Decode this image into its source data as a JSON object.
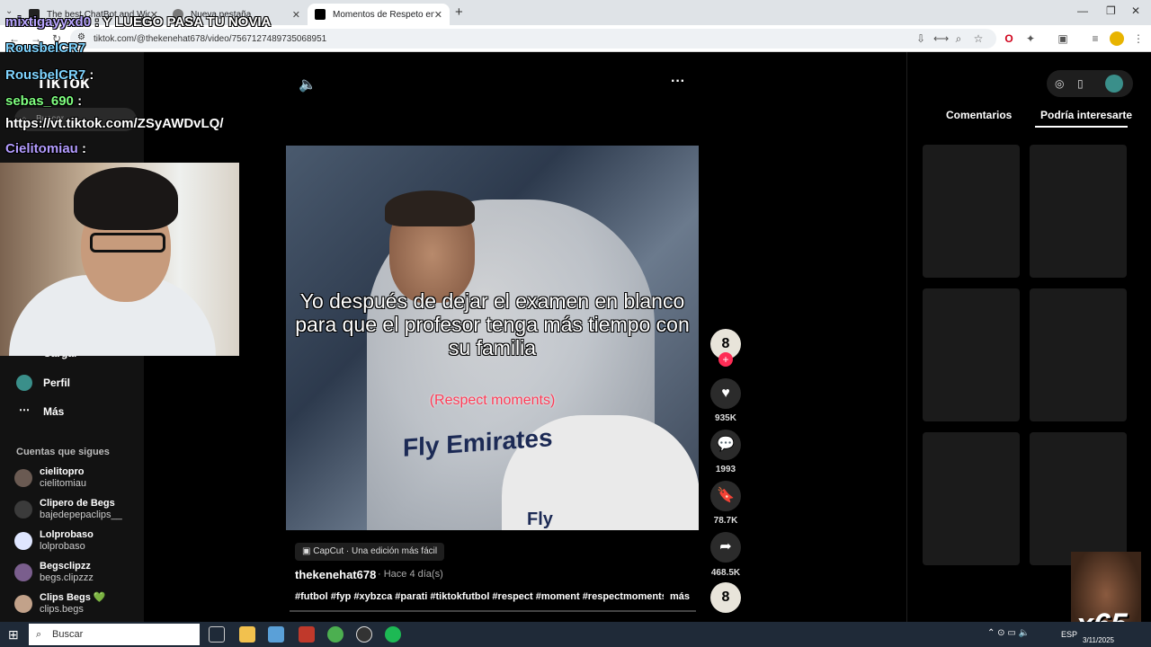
{
  "browser": {
    "tabs": [
      {
        "title": "The best ChatBot and Widgets"
      },
      {
        "title": "Nueva pestaña"
      },
      {
        "title": "Momentos de Respeto en"
      }
    ],
    "new_tab_symbol": "+",
    "url": "tiktok.com/@thekenehat678/video/7567127489735068951"
  },
  "tiktok": {
    "logo": "TikTok",
    "search_placeholder": "Buscar",
    "nav": [
      {
        "label": "Cargar",
        "icon": "upload-icon"
      },
      {
        "label": "Perfil",
        "icon": "profile-icon"
      },
      {
        "label": "Más",
        "icon": "more-icon"
      }
    ],
    "following_title": "Cuentas que sigues",
    "following": [
      {
        "name": "cielitopro",
        "user": "cielitomiau",
        "color": "#6a5a52"
      },
      {
        "name": "Clipero de Begs",
        "user": "bajedepepaclips__",
        "color": "#3b3b3b"
      },
      {
        "name": "Lolprobaso",
        "user": "lolprobaso",
        "color": "#dfe6ff"
      },
      {
        "name": "Begsclipzz",
        "user": "begs.clipzzz",
        "color": "#7a5e8d"
      },
      {
        "name": "Clips Begs 💚",
        "user": "clips.begs",
        "color": "#c2a28a"
      }
    ],
    "video": {
      "caption": "Yo después de dejar el examen en blanco para que el profesor tenga más tiempo con su familia",
      "caption_sub": "(Respect moments)",
      "jersey": "Fly Emirates",
      "jersey2": "Fly",
      "capcut_label": "CapCut · Una edición más fácil",
      "author": "thekenehat678",
      "time": "· Hace 4 día(s)",
      "hashtags": "#futbol #fyp #xybzca #parati #tiktokfutbol #respect #moment #respectmoments...",
      "more": "más",
      "more_menu": "···",
      "likes": "935K",
      "comments": "1993",
      "saves": "78.7K",
      "shares": "468.5K"
    },
    "panel_tabs": {
      "comments": "Comentarios",
      "recommended": "Podría interesarte"
    }
  },
  "stream_overlay": {
    "chat": [
      {
        "user": "mixtigayyxd0",
        "msg": ": Y LUEGO PASA TU NOVIA",
        "color": "#b9a6ff"
      },
      {
        "user": "RousbelCR7",
        "msg": "",
        "color": "#7fd4ff"
      },
      {
        "user": "RousbelCR7",
        "msg": ":",
        "color": "#7fd4ff"
      },
      {
        "user": "sebas_690",
        "msg": ":",
        "color": "#7fff7f"
      },
      {
        "user": "",
        "msg": "https://vt.tiktok.com/ZSyAWDvLQ/",
        "color": "#ffffff"
      },
      {
        "user": "Cielitomiau",
        "msg": ":",
        "color": "#b39cff"
      }
    ],
    "meme_text": "x65"
  },
  "taskbar": {
    "search_placeholder": "Buscar",
    "language": "ESP",
    "date": "3/11/2025"
  }
}
